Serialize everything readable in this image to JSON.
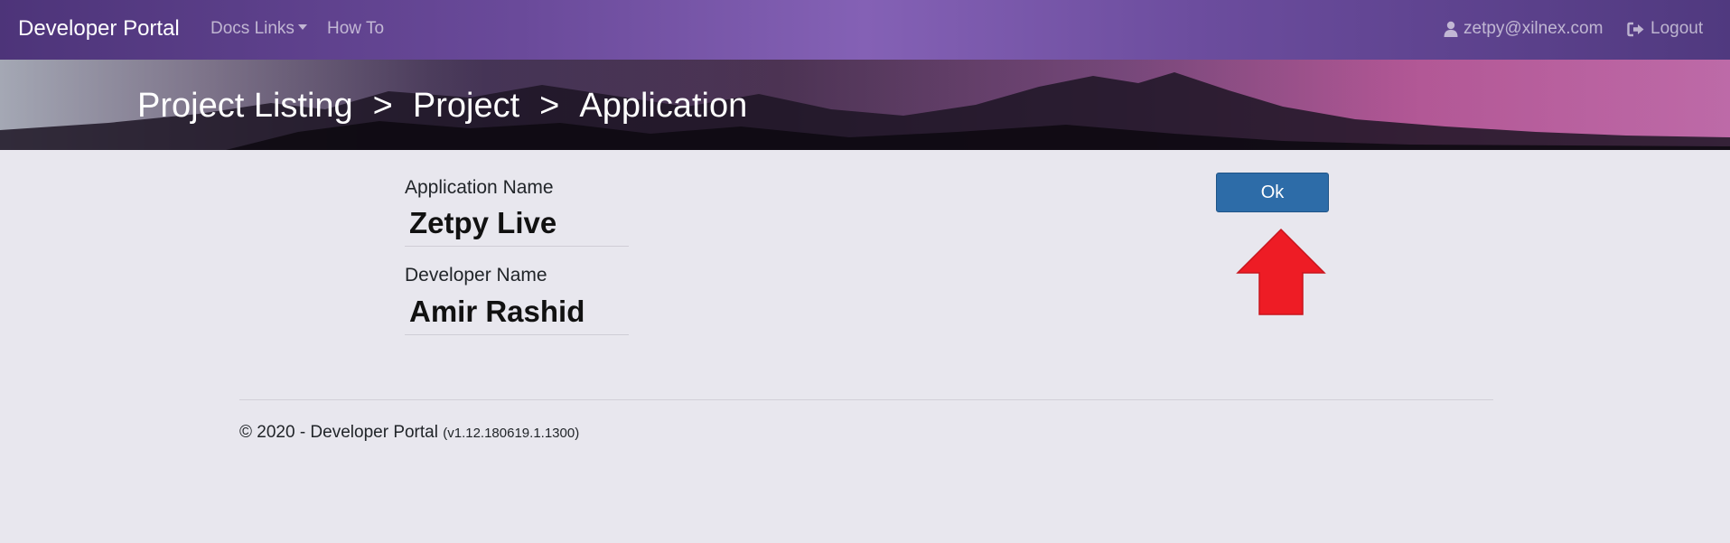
{
  "navbar": {
    "brand": "Developer Portal",
    "docs_links": "Docs Links",
    "how_to": "How To",
    "user_email": "zetpy@xilnex.com",
    "logout": "Logout",
    "user_icon": "user-icon",
    "logout_icon": "sign-out-icon"
  },
  "breadcrumb": {
    "items": [
      "Project Listing",
      "Project",
      "Application"
    ],
    "separator": ">"
  },
  "form": {
    "app_name_label": "Application Name",
    "app_name_value": "Zetpy Live",
    "dev_name_label": "Developer Name",
    "dev_name_value": "Amir Rashid"
  },
  "actions": {
    "ok_label": "Ok",
    "arrow_color": "#ee1c25",
    "button_color": "#2d6ca8"
  },
  "footer": {
    "copyright": "© 2020 - Developer Portal",
    "version": "(v1.12.180619.1.1300)"
  }
}
